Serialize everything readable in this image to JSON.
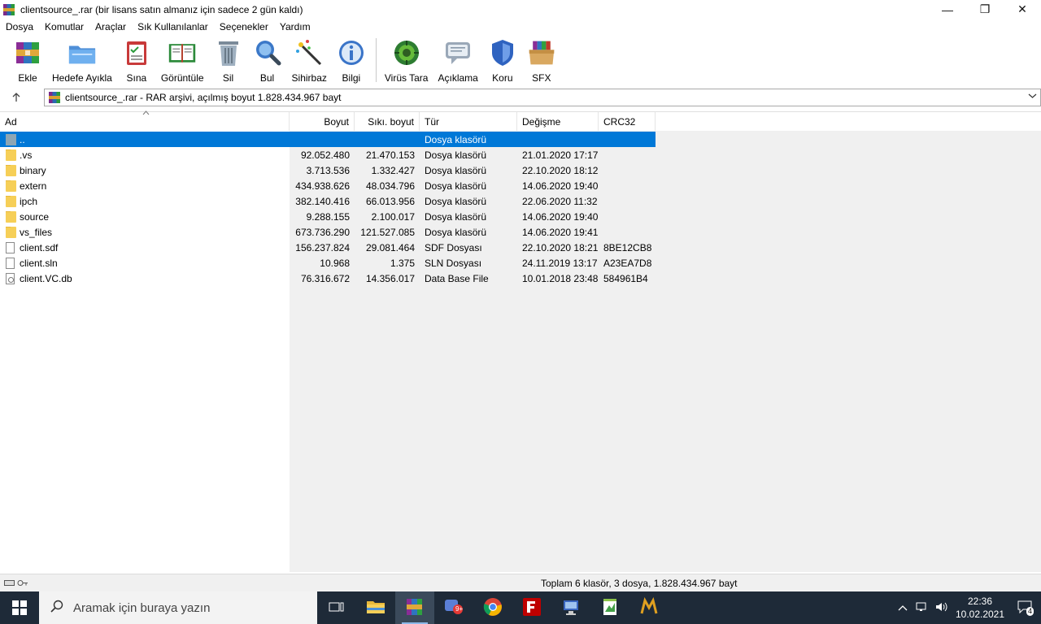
{
  "window": {
    "title": "clientsource_.rar (bir lisans satın almanız için sadece 2 gün kaldı)",
    "minimize": "—",
    "restore": "❐",
    "close": "✕"
  },
  "menu": [
    "Dosya",
    "Komutlar",
    "Araçlar",
    "Sık Kullanılanlar",
    "Seçenekler",
    "Yardım"
  ],
  "toolbar": [
    {
      "label": "Ekle",
      "icon": "add-archive-icon"
    },
    {
      "label": "Hedefe Ayıkla",
      "icon": "extract-to-icon"
    },
    {
      "label": "Sına",
      "icon": "test-icon"
    },
    {
      "label": "Görüntüle",
      "icon": "view-book-icon"
    },
    {
      "label": "Sil",
      "icon": "trash-icon"
    },
    {
      "label": "Bul",
      "icon": "find-magnifier-icon"
    },
    {
      "label": "Sihirbaz",
      "icon": "wizard-wand-icon"
    },
    {
      "label": "Bilgi",
      "icon": "info-icon"
    },
    {
      "label": "Virüs Tara",
      "icon": "virus-scan-icon"
    },
    {
      "label": "Açıklama",
      "icon": "comment-icon"
    },
    {
      "label": "Koru",
      "icon": "protect-shield-icon"
    },
    {
      "label": "SFX",
      "icon": "sfx-box-icon"
    }
  ],
  "address": {
    "path": "clientsource_.rar - RAR arşivi, açılmış boyut 1.828.434.967 bayt"
  },
  "columns": {
    "name": "Ad",
    "size": "Boyut",
    "packed": "Sıkı. boyut",
    "type": "Tür",
    "modified": "Değişme",
    "crc": "CRC32"
  },
  "rows": [
    {
      "name": "..",
      "size": "",
      "packed": "",
      "type": "Dosya klasörü",
      "modified": "",
      "crc": "",
      "kind": "up"
    },
    {
      "name": ".vs",
      "size": "92.052.480",
      "packed": "21.470.153",
      "type": "Dosya klasörü",
      "modified": "21.01.2020 17:17",
      "crc": "",
      "kind": "folder"
    },
    {
      "name": "binary",
      "size": "3.713.536",
      "packed": "1.332.427",
      "type": "Dosya klasörü",
      "modified": "22.10.2020 18:12",
      "crc": "",
      "kind": "folder"
    },
    {
      "name": "extern",
      "size": "434.938.626",
      "packed": "48.034.796",
      "type": "Dosya klasörü",
      "modified": "14.06.2020 19:40",
      "crc": "",
      "kind": "folder"
    },
    {
      "name": "ipch",
      "size": "382.140.416",
      "packed": "66.013.956",
      "type": "Dosya klasörü",
      "modified": "22.06.2020 11:32",
      "crc": "",
      "kind": "folder"
    },
    {
      "name": "source",
      "size": "9.288.155",
      "packed": "2.100.017",
      "type": "Dosya klasörü",
      "modified": "14.06.2020 19:40",
      "crc": "",
      "kind": "folder"
    },
    {
      "name": "vs_files",
      "size": "673.736.290",
      "packed": "121.527.085",
      "type": "Dosya klasörü",
      "modified": "14.06.2020 19:41",
      "crc": "",
      "kind": "folder"
    },
    {
      "name": "client.sdf",
      "size": "156.237.824",
      "packed": "29.081.464",
      "type": "SDF Dosyası",
      "modified": "22.10.2020 18:21",
      "crc": "8BE12CB8",
      "kind": "file"
    },
    {
      "name": "client.sln",
      "size": "10.968",
      "packed": "1.375",
      "type": "SLN Dosyası",
      "modified": "24.11.2019 13:17",
      "crc": "A23EA7D8",
      "kind": "file"
    },
    {
      "name": "client.VC.db",
      "size": "76.316.672",
      "packed": "14.356.017",
      "type": "Data Base File",
      "modified": "10.01.2018 23:48",
      "crc": "584961B4",
      "kind": "db"
    }
  ],
  "status": {
    "text": "Toplam 6 klasör, 3 dosya, 1.828.434.967 bayt"
  },
  "taskbar": {
    "search_placeholder": "Aramak için buraya yazın",
    "time": "22:36",
    "date": "10.02.2021",
    "notification_count": "4",
    "chat_badge": "9+"
  },
  "colors": {
    "selection": "#0078d7",
    "taskbar": "#1e2a38",
    "folder": "#f6cf57"
  }
}
